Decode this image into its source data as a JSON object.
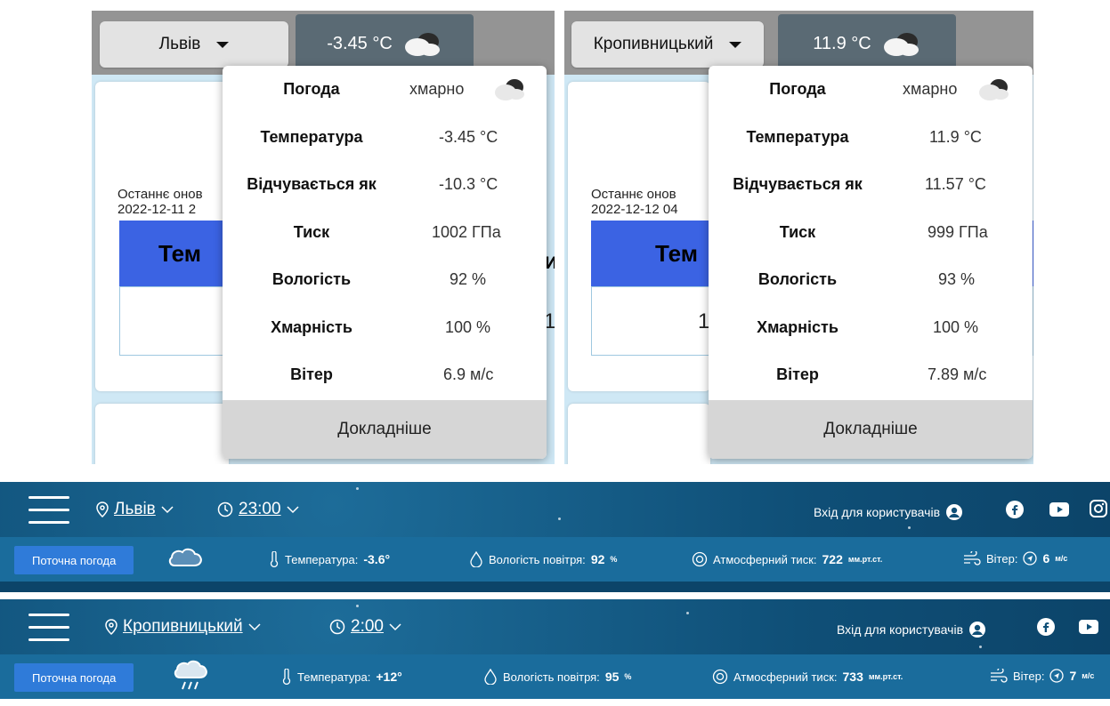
{
  "panels": [
    {
      "city": "Львів",
      "temp": "-3.45 °C",
      "updated_label": "Останнє онов",
      "updated_date": "2022-12-11 2",
      "table_head": "Тем",
      "table_partial_left": "",
      "table_partial_right": "и",
      "table_cell_right": "1",
      "popup": {
        "rows": [
          {
            "label": "Погода",
            "value": "хмарно"
          },
          {
            "label": "Температура",
            "value": "-3.45 °C"
          },
          {
            "label": "Відчувається як",
            "value": "-10.3 °C"
          },
          {
            "label": "Тиск",
            "value": "1002 ГПа"
          },
          {
            "label": "Вологість",
            "value": "92 %"
          },
          {
            "label": "Хмарність",
            "value": "100 %"
          },
          {
            "label": "Вітер",
            "value": "6.9 м/с"
          }
        ],
        "more": "Докладніше"
      }
    },
    {
      "city": "Кропивницький",
      "temp": "11.9 °C",
      "updated_label": "Останнє онов",
      "updated_date": "2022-12-12 04",
      "table_head": "Тем",
      "table_cell_left": "1",
      "popup": {
        "rows": [
          {
            "label": "Погода",
            "value": "хмарно"
          },
          {
            "label": "Температура",
            "value": "11.9 °C"
          },
          {
            "label": "Відчувається як",
            "value": "11.57 °C"
          },
          {
            "label": "Тиск",
            "value": "999 ГПа"
          },
          {
            "label": "Вологість",
            "value": "93 %"
          },
          {
            "label": "Хмарність",
            "value": "100 %"
          },
          {
            "label": "Вітер",
            "value": "7.89 м/с"
          }
        ],
        "more": "Докладніше"
      }
    }
  ],
  "strips": [
    {
      "city": "Львів",
      "time": "23:00",
      "login": "Вхід для користувачів",
      "current_btn": "Поточна погода",
      "temp_label": "Температура:",
      "temp_value": "-3.6°",
      "humidity_label": "Вологість повітря:",
      "humidity_value": "92",
      "humidity_unit": "%",
      "pressure_label": "Атмосферний тиск:",
      "pressure_value": "722",
      "pressure_unit": "мм.рт.ст.",
      "wind_label": "Вітер:",
      "wind_value": "6",
      "wind_unit": "м/с"
    },
    {
      "city": "Кропивницький",
      "time": "2:00",
      "login": "Вхід для користувачів",
      "current_btn": "Поточна погода",
      "temp_label": "Температура:",
      "temp_value": "+12°",
      "humidity_label": "Вологість повітря:",
      "humidity_value": "95",
      "humidity_unit": "%",
      "pressure_label": "Атмосферний тиск:",
      "pressure_value": "733",
      "pressure_unit": "мм.рт.ст.",
      "wind_label": "Вітер:",
      "wind_value": "7",
      "wind_unit": "м/с"
    }
  ],
  "colors": {
    "nav_dark": "#0f4f77",
    "sub_bar": "#1a6c9c",
    "button_blue": "#2f7bd9",
    "table_head_blue": "#3b63e3"
  }
}
